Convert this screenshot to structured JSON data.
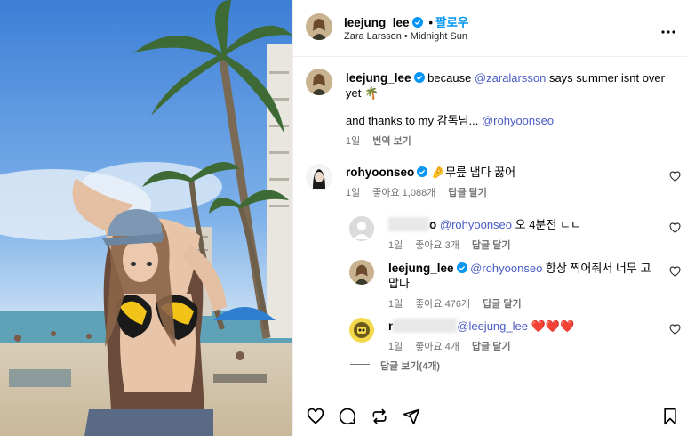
{
  "header": {
    "username": "leejung_lee",
    "follow_label": "팔로우",
    "separator": "•",
    "music_artist": "Zara Larsson",
    "music_dot": "•",
    "music_title": "Midnight Sun"
  },
  "caption": {
    "username": "leejung_lee",
    "text_pre": "because ",
    "mention1": "@zaralarsson",
    "text_post": " says summer isnt over yet 🌴",
    "line2_pre": "and thanks to my 감독님...",
    "line2_mention": "@rohyoonseo",
    "time": "1일",
    "translate": "번역 보기"
  },
  "comments": [
    {
      "username": "rohyoonseo",
      "text": "🤌무릎 냅다 꿇어",
      "time": "1일",
      "likes": "좋아요 1,088개",
      "reply": "답글 달기"
    }
  ],
  "replies": [
    {
      "username_tail": "o",
      "mention": "@rohyoonseo",
      "text": " 오 4분전 ㄷㄷ",
      "time": "1일",
      "likes": "좋아요 3개",
      "reply": "답글 달기"
    },
    {
      "username": "leejung_lee",
      "mention": "@rohyoonseo",
      "text": " 항상 찍어줘서 너무 고맙다.",
      "time": "1일",
      "likes": "좋아요 476개",
      "reply": "답글 달기"
    },
    {
      "username_head": "r",
      "mention": "@leejung_lee",
      "text": " ❤️❤️❤️",
      "time": "1일",
      "likes": "좋아요 4개",
      "reply": "답글 달기"
    }
  ],
  "view_replies": "답글 보기(4개)",
  "colors": {
    "accent": "#0095f6",
    "mention": "#4a5cc6",
    "secondary": "#737373"
  },
  "icons": [
    "more-icon",
    "heart-icon",
    "comment-icon",
    "share-icon",
    "send-icon",
    "bookmark-icon",
    "verified-icon"
  ]
}
